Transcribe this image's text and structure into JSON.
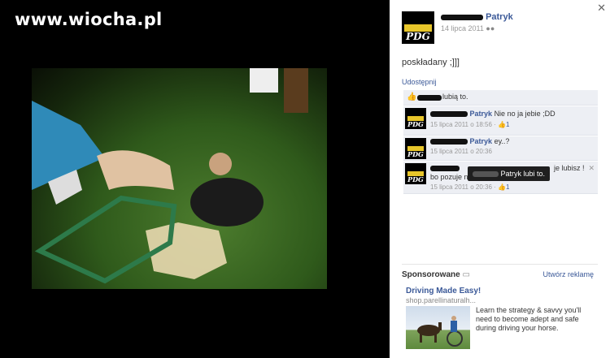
{
  "watermark": "www.wiocha.pl",
  "post": {
    "author": "Patryk",
    "date": "14 lipca 2011",
    "status": "poskładany ;]]]",
    "share_label": "Udostępnij",
    "likes_text": "lubią to.",
    "avatar_text": "PDG"
  },
  "comments": [
    {
      "author": "Patryk",
      "text": "Nie no ja jebie ;DD",
      "time": "15 lipca 2011 o 18:56",
      "likes": "1"
    },
    {
      "author": "Patryk",
      "text": "ey..?",
      "time": "15 lipca 2011 o 20:36",
      "likes": ""
    },
    {
      "author": "",
      "text_line1": "je lubisz !",
      "text_line2": "bo pozuje n",
      "time": "15 lipca 2011 o 20:36",
      "likes": "1"
    }
  ],
  "tooltip": "Patryk lubi to.",
  "ads": {
    "sponsored_label": "Sponsorowane",
    "create_label": "Utwórz reklamę",
    "title": "Driving Made Easy!",
    "url": "shop.parellinaturalh...",
    "body": "Learn the strategy & savvy you'll need to become adept and safe during driving your horse."
  },
  "icons": {
    "close": "close-icon",
    "privacy": "people-icon",
    "thumb": "thumbs-up-icon",
    "sponsored": "speech-icon"
  }
}
